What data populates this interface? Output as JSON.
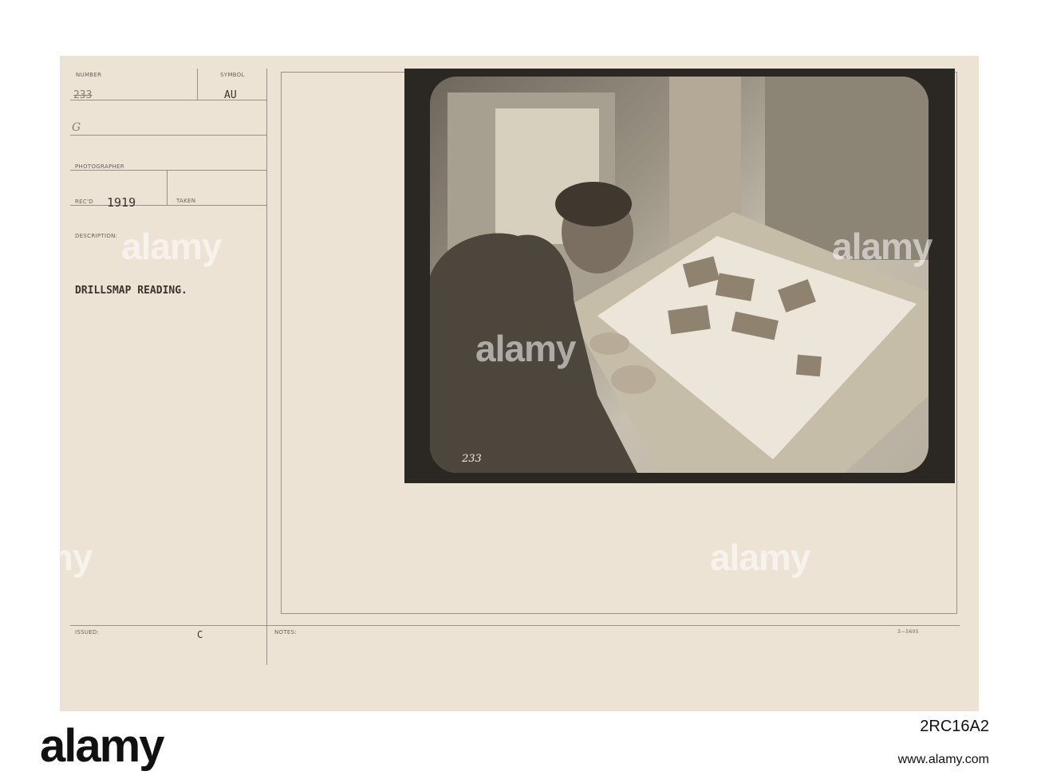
{
  "card": {
    "number_label": "NUMBER",
    "number_value": "233",
    "symbol_label": "SYMBOL",
    "symbol_value": "AU",
    "hand_mark": "G",
    "photographer_label": "PHOTOGRAPHER",
    "recd_label": "REC'D",
    "recd_value": "1919",
    "taken_label": "TAKEN",
    "description_label": "DESCRIPTION:",
    "description_value": "DRILLSMAP READING.",
    "issued_label": "ISSUED:",
    "issued_value": "C",
    "notes_label": "NOTES:",
    "form_code": "3—5605"
  },
  "photo": {
    "negative_number": "233"
  },
  "watermark": {
    "text": "alamy"
  },
  "footer": {
    "logo": "alamy",
    "image_id": "2RC16A2",
    "site": "www.alamy.com"
  }
}
